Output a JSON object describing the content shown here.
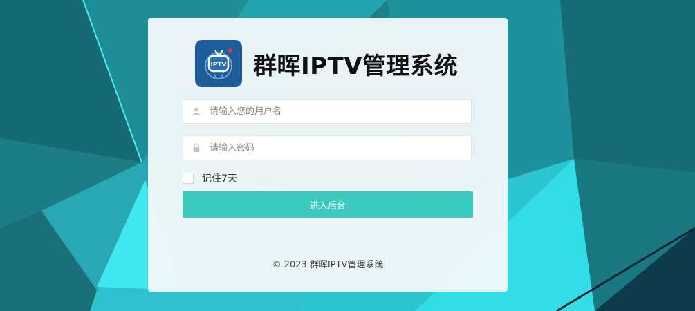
{
  "app": {
    "title": "群晖IPTV管理系统"
  },
  "logo": {
    "text": "IPTV",
    "icon": "tv-globe-icon",
    "bg_color": "#1d5d9b"
  },
  "form": {
    "username_placeholder": "请输入您的用户名",
    "password_placeholder": "请输入密码",
    "remember_label": "记住7天",
    "remember_checked": false,
    "submit_label": "进入后台"
  },
  "footer": {
    "copyright": "© 2023 群晖IPTV管理系统"
  },
  "colors": {
    "accent": "#3bcbbe",
    "background": "#1b7f89"
  }
}
